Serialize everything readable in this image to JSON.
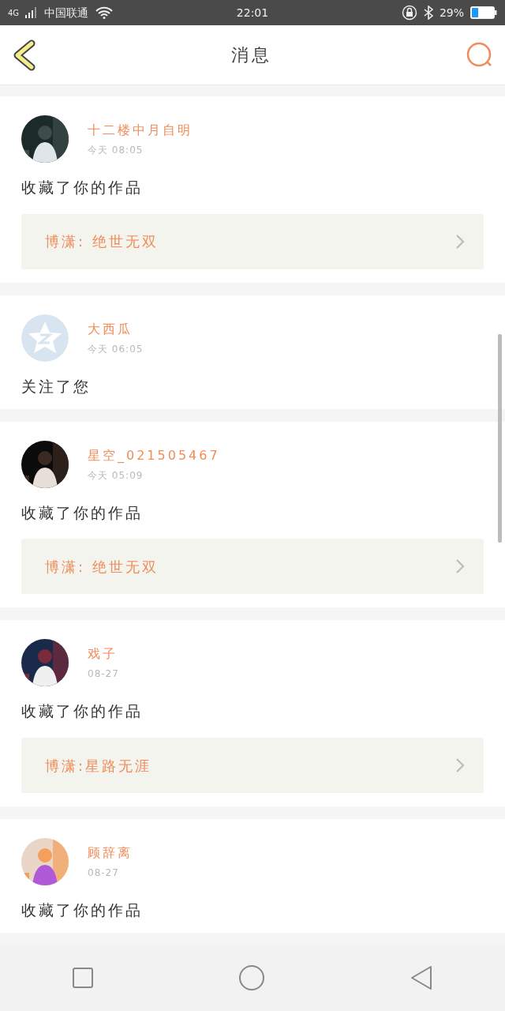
{
  "status_bar": {
    "network": "4G",
    "carrier": "中国联通",
    "time": "22:01",
    "battery": "29%"
  },
  "header": {
    "title": "消息"
  },
  "messages": [
    {
      "name": "十二楼中月自明",
      "time": "今天 08:05",
      "action": "收藏了你的作品",
      "work": "博潇:  绝世无双"
    },
    {
      "name": "大西瓜",
      "time": "今天 06:05",
      "avatar": {
        "kind": "default"
      },
      "action": "关注了您"
    },
    {
      "name": "星空_021505467",
      "time": "今天 05:09",
      "action": "收藏了你的作品",
      "work": "博潇:  绝世无双"
    },
    {
      "name": "戏子",
      "time": "08-27",
      "action": "收藏了你的作品",
      "work": "博潇:星路无涯"
    },
    {
      "name": "顾辞离",
      "time": "08-27",
      "action": "收藏了你的作品"
    }
  ]
}
